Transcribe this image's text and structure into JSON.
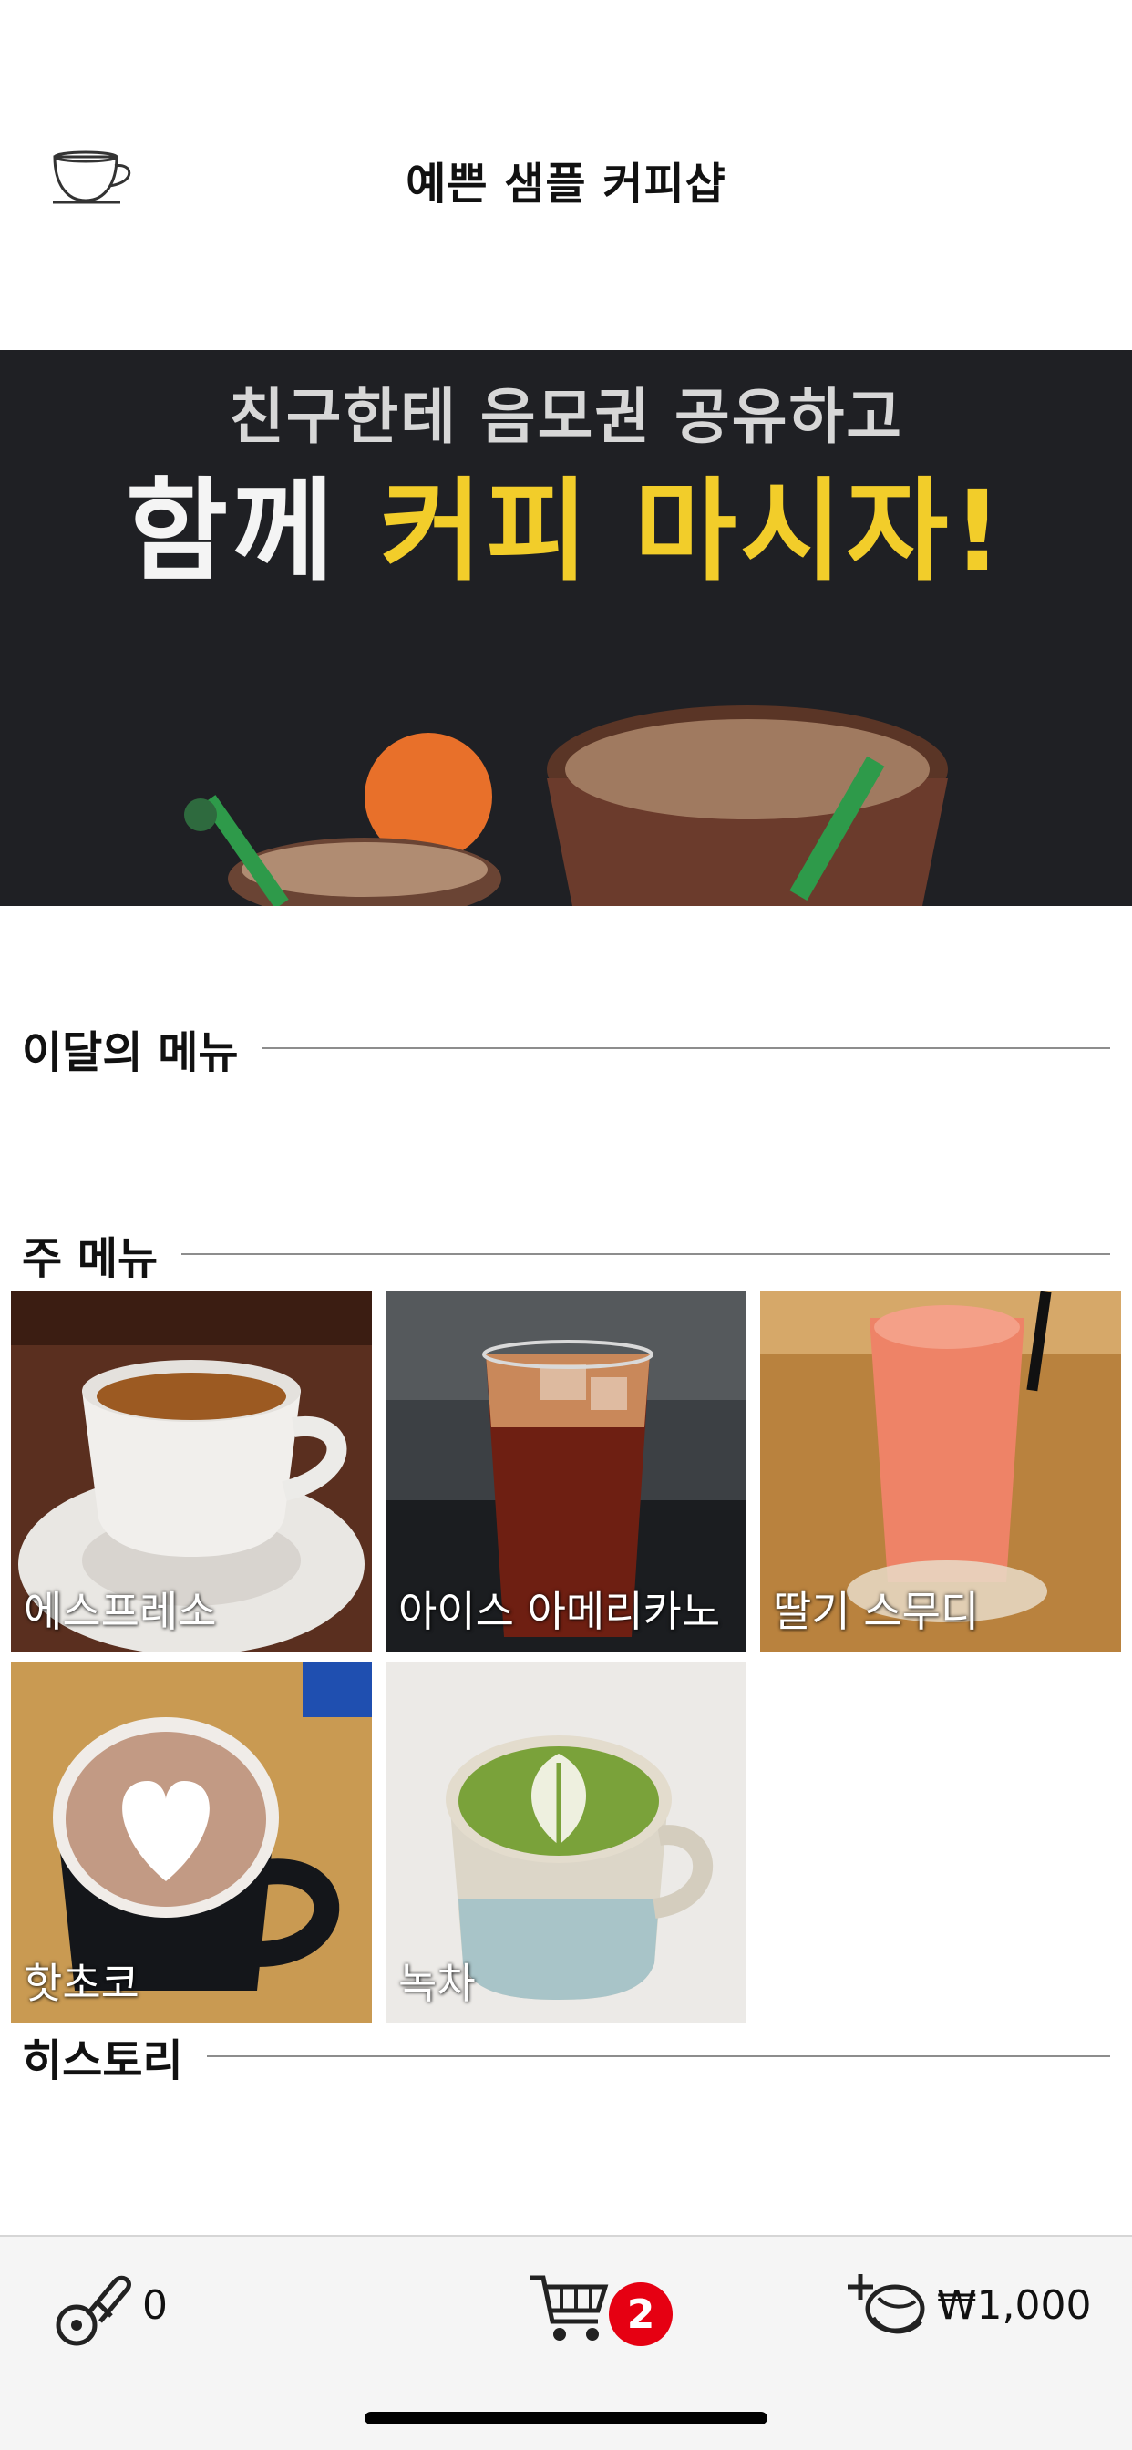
{
  "header": {
    "title": "예쁜 샘플 커피샵",
    "logo_icon": "coffee-cup-icon"
  },
  "banner": {
    "line1": "친구한테 음모권 공유하고",
    "line2_white": "함께 ",
    "line2_yellow": "커피 마시자!",
    "colors": {
      "background": "#1f2024",
      "highlight": "#f2cd2a"
    }
  },
  "sections": {
    "monthly": "이달의 메뉴",
    "main": "주 메뉴",
    "history": "히스토리"
  },
  "menu_items": [
    {
      "label": "에스프레소",
      "icon": "espresso-photo"
    },
    {
      "label": "아이스 아메리카노",
      "icon": "iced-americano-photo"
    },
    {
      "label": "딸기 스무디",
      "icon": "strawberry-smoothie-photo"
    },
    {
      "label": "핫초코",
      "icon": "hot-chocolate-photo"
    },
    {
      "label": "녹차",
      "icon": "green-tea-latte-photo"
    }
  ],
  "bottom_bar": {
    "stamp_count": "0",
    "cart_badge": "2",
    "balance": "₩1,000",
    "icons": [
      "stamp-icon",
      "cart-icon",
      "add-coin-icon"
    ],
    "badge_color": "#e60012"
  }
}
